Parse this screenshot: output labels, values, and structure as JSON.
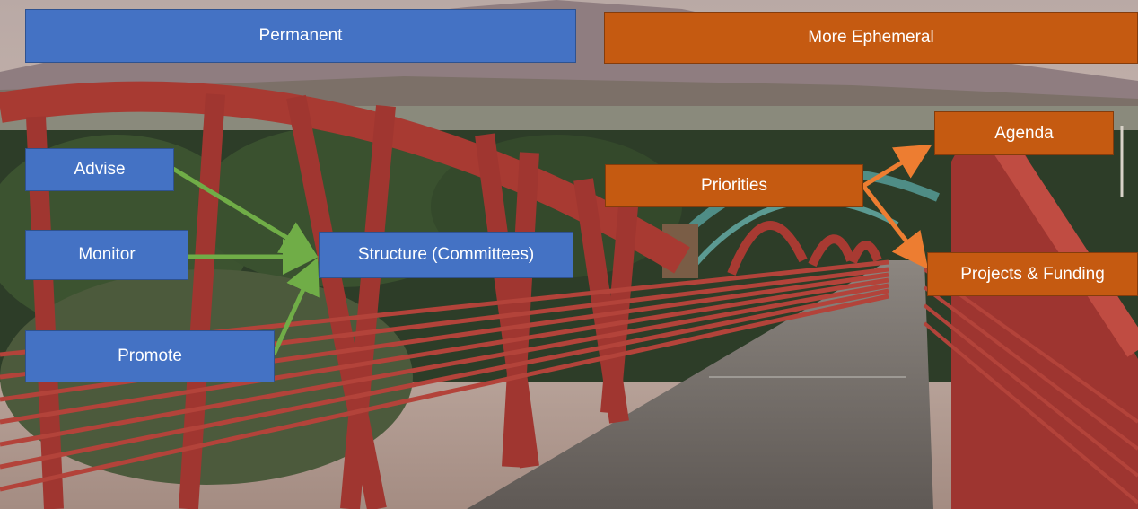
{
  "headers": {
    "permanent": "Permanent",
    "ephemeral": "More Ephemeral"
  },
  "left_nodes": {
    "advise": "Advise",
    "monitor": "Monitor",
    "promote": "Promote",
    "structure": "Structure (Committees)"
  },
  "right_nodes": {
    "priorities": "Priorities",
    "agenda": "Agenda",
    "projects": "Projects & Funding"
  },
  "colors": {
    "permanent_box": "#4472c4",
    "ephemeral_box": "#c55a11",
    "green_arrow": "#70ad47",
    "orange_arrow": "#ed7d31",
    "bridge": "#a83a32"
  }
}
